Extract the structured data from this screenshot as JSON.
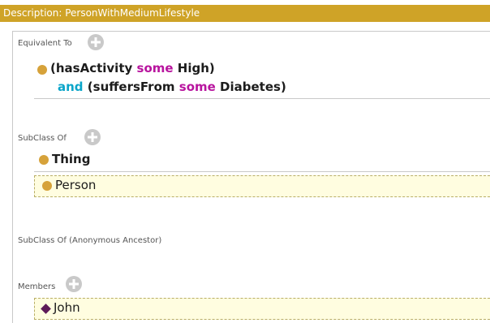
{
  "title": "Description: PersonWithMediumLifestyle",
  "sections": {
    "equivalent_to": {
      "label": "Equivalent To",
      "expression": {
        "open_paren": "(",
        "prop1": "hasActivity",
        "some1": "some",
        "val1": "High)",
        "and": "and",
        "open2": "(",
        "prop2": "suffersFrom",
        "some2": "some",
        "val2": "Diabetes)"
      }
    },
    "subclass_of": {
      "label": "SubClass Of",
      "items": [
        "Thing",
        "Person"
      ]
    },
    "subclass_anon": {
      "label": "SubClass Of (Anonymous Ancestor)"
    },
    "members": {
      "label": "Members",
      "items": [
        "John"
      ]
    }
  },
  "colors": {
    "title_bar": "#cfa327",
    "class_dot": "#d6a23a",
    "individual_diamond": "#5e1b59",
    "keyword_and": "#0aa5c9",
    "keyword_some": "#b8149e"
  }
}
